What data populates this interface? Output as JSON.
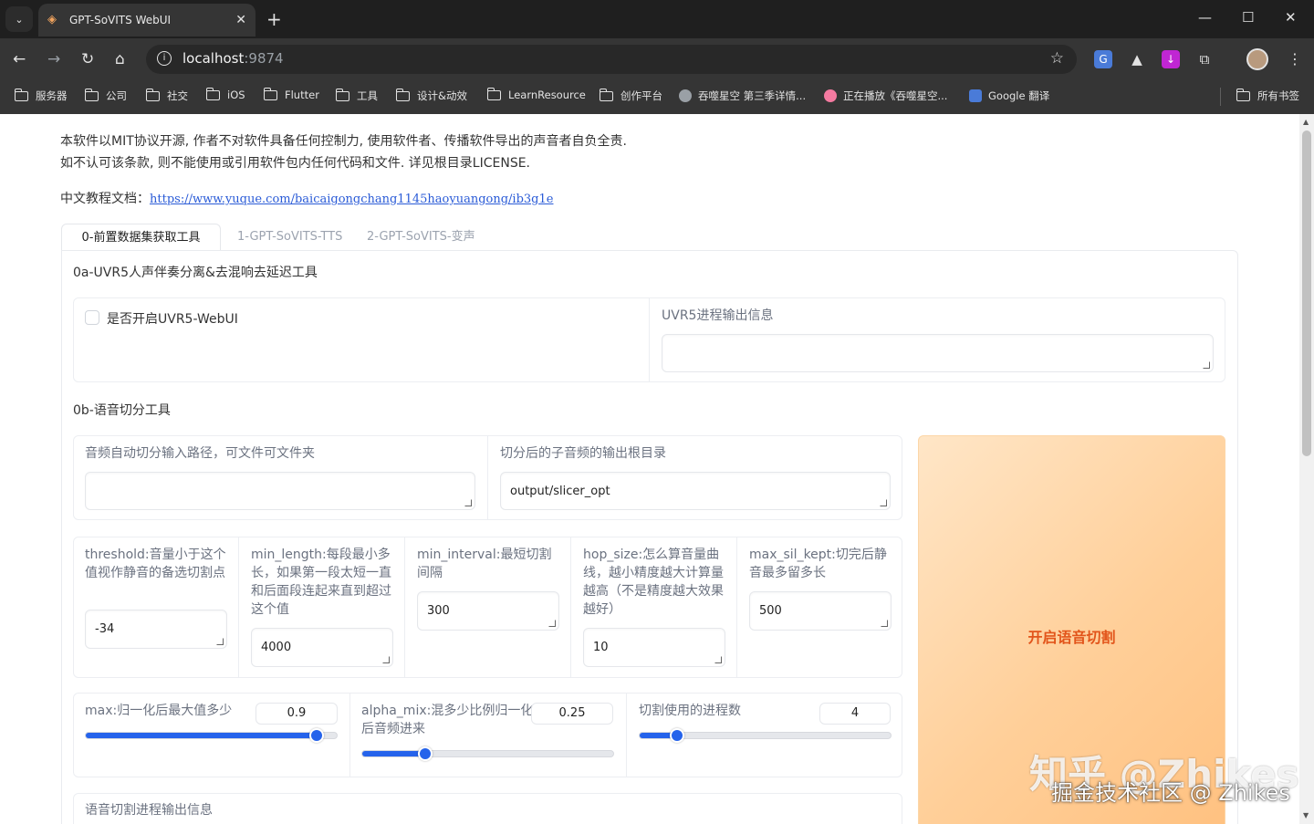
{
  "browser": {
    "tab_title": "GPT-SoVITS WebUI",
    "url_host": "localhost",
    "url_port": ":9874",
    "bookmarks": [
      "服务器",
      "公司",
      "社交",
      "iOS",
      "Flutter",
      "工具",
      "设计&动效",
      "LearnResource",
      "创作平台",
      "吞噬星空 第三季详情...",
      "正在播放《吞噬星空...",
      "Google 翻译"
    ],
    "all_bookmarks": "所有书签"
  },
  "header": {
    "license_line1": "本软件以MIT协议开源, 作者不对软件具备任何控制力, 使用软件者、传播软件导出的声音者自负全责.",
    "license_line2": "如不认可该条款, 则不能使用或引用软件包内任何代码和文件. 详见根目录LICENSE.",
    "doc_label": "中文教程文档：",
    "doc_link": "https://www.yuque.com/baicaigongchang1145haoyuangong/ib3g1e"
  },
  "tabs": [
    "0-前置数据集获取工具",
    "1-GPT-SoVITS-TTS",
    "2-GPT-SoVITS-变声"
  ],
  "uvr5": {
    "section_title": "0a-UVR5人声伴奏分离&去混响去延迟工具",
    "checkbox_label": "是否开启UVR5-WebUI",
    "output_label": "UVR5进程输出信息",
    "output_value": ""
  },
  "slicer": {
    "section_title": "0b-语音切分工具",
    "input_path_label": "音频自动切分输入路径，可文件可文件夹",
    "input_path_value": "",
    "output_root_label": "切分后的子音频的输出根目录",
    "output_root_value": "output/slicer_opt",
    "threshold_label": "threshold:音量小于这个值视作静音的备选切割点",
    "threshold_value": "-34",
    "min_length_label": "min_length:每段最小多长，如果第一段太短一直和后面段连起来直到超过这个值",
    "min_length_value": "4000",
    "min_interval_label": "min_interval:最短切割间隔",
    "min_interval_value": "300",
    "hop_size_label": "hop_size:怎么算音量曲线，越小精度越大计算量越高（不是精度越大效果越好）",
    "hop_size_value": "10",
    "max_sil_label": "max_sil_kept:切完后静音最多留多长",
    "max_sil_value": "500",
    "max_label": "max:归一化后最大值多少",
    "max_value": "0.9",
    "max_fraction": 0.92,
    "alpha_label": "alpha_mix:混多少比例归一化后音频进来",
    "alpha_value": "0.25",
    "alpha_fraction": 0.25,
    "procs_label": "切割使用的进程数",
    "procs_value": "4",
    "procs_fraction": 0.15,
    "start_button": "开启语音切割",
    "progress_label": "语音切割进程输出信息"
  },
  "watermark": {
    "line1": "知乎 @Zhikes",
    "line2": "掘金技术社区 @ Zhikes"
  },
  "colors": {
    "accent": "#2563eb",
    "button_text": "#e2551b",
    "button_bg": "#ffcf99"
  }
}
